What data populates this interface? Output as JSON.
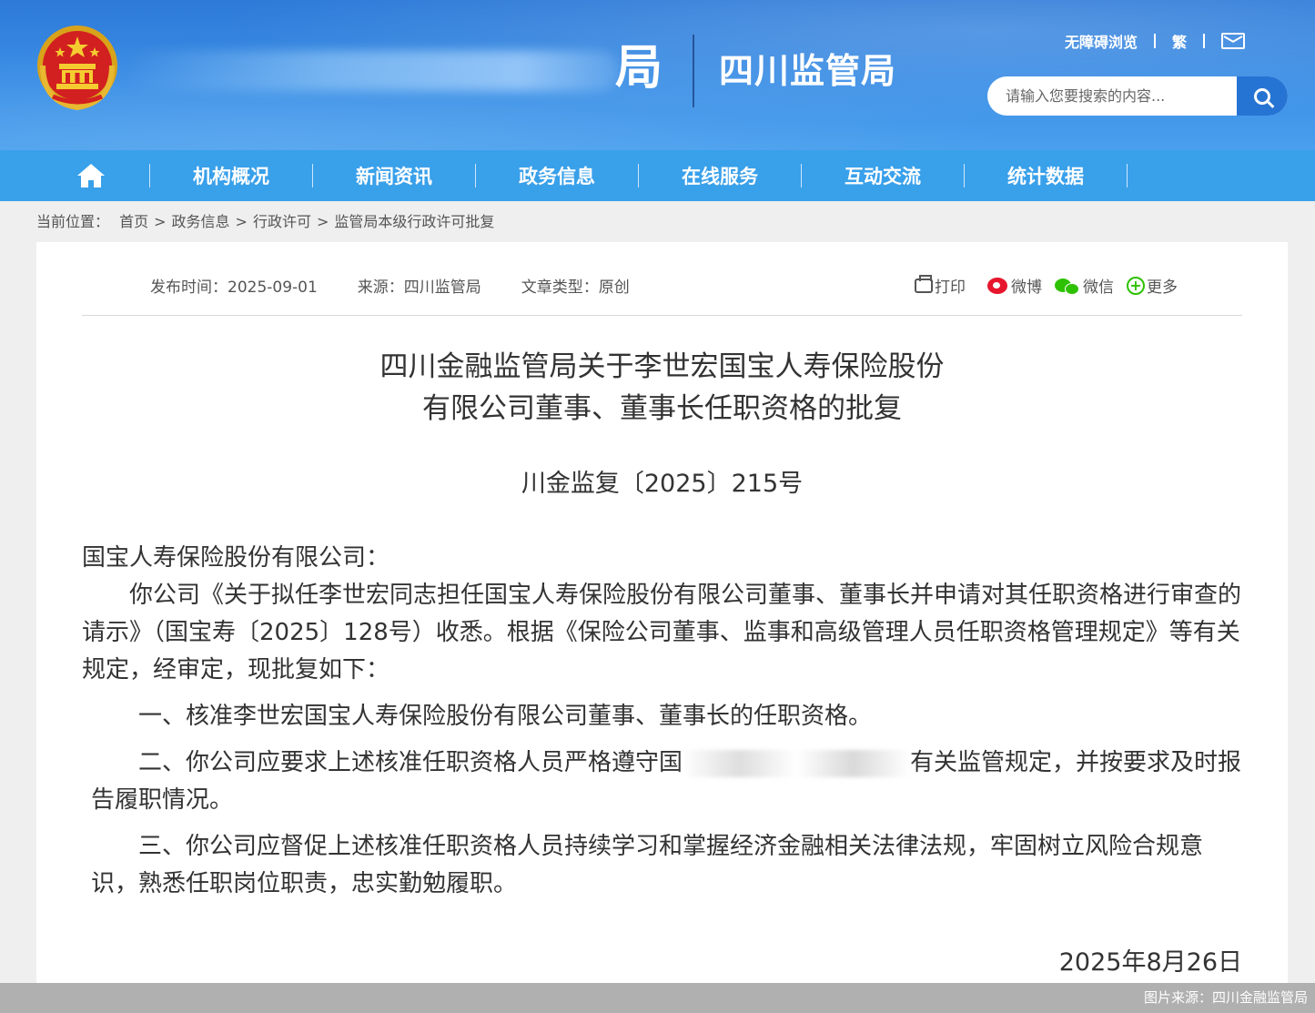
{
  "header": {
    "title_fragment": "局",
    "org_name": "四川监管局",
    "accessibility_label": "无障碍浏览",
    "traditional_label": "繁",
    "mail_icon": "mail-icon",
    "search_placeholder": "请输入您要搜索的内容...",
    "search_icon": "search-icon"
  },
  "nav": {
    "home_icon": "home-icon",
    "items": [
      {
        "label": "机构概况"
      },
      {
        "label": "新闻资讯"
      },
      {
        "label": "政务信息"
      },
      {
        "label": "在线服务"
      },
      {
        "label": "互动交流"
      },
      {
        "label": "统计数据"
      }
    ]
  },
  "breadcrumb": {
    "prefix": "当前位置：",
    "items": [
      "首页",
      "政务信息",
      "行政许可",
      "监管局本级行政许可批复"
    ],
    "separator": ">"
  },
  "article": {
    "publish_time": "发布时间：2025-09-01",
    "source": "来源：四川监管局",
    "type": "文章类型：原创",
    "share": {
      "print": "打印",
      "weibo": "微博",
      "wechat": "微信",
      "more": "更多"
    },
    "title_line1": "四川金融监管局关于李世宏国宝人寿保险股份",
    "title_line2": "有限公司董事、董事长任职资格的批复",
    "doc_number": "川金监复〔2025〕215号",
    "salutation": "国宝人寿保险股份有限公司：",
    "para1": "你公司《关于拟任李世宏同志担任国宝人寿保险股份有限公司董事、董事长并申请对其任职资格进行审查的请示》（国宝寿〔2025〕128号）收悉。根据《保险公司董事、监事和高级管理人员任职资格管理规定》等有关规定，经审定，现批复如下：",
    "item1": "一、核准李世宏国宝人寿保险股份有限公司董事、董事长的任职资格。",
    "item2_a": "二、你公司应要求上述核准任职资格人员严格遵守国",
    "item2_b": "有关监管规定，并按要求及时报告履职情况。",
    "item3": "三、你公司应督促上述核准任职资格人员持续学习和掌握经济金融相关法律法规，牢固树立风险合规意识，熟悉任职岗位职责，忠实勤勉履职。",
    "date": "2025年8月26日"
  },
  "watermark": "图片来源：四川金融监管局",
  "colors": {
    "header_blue": "#2d7ad8",
    "nav_blue": "#39a0ea",
    "search_button": "#2574d4",
    "weibo_red": "#e6162d",
    "wechat_green": "#2dc100"
  }
}
